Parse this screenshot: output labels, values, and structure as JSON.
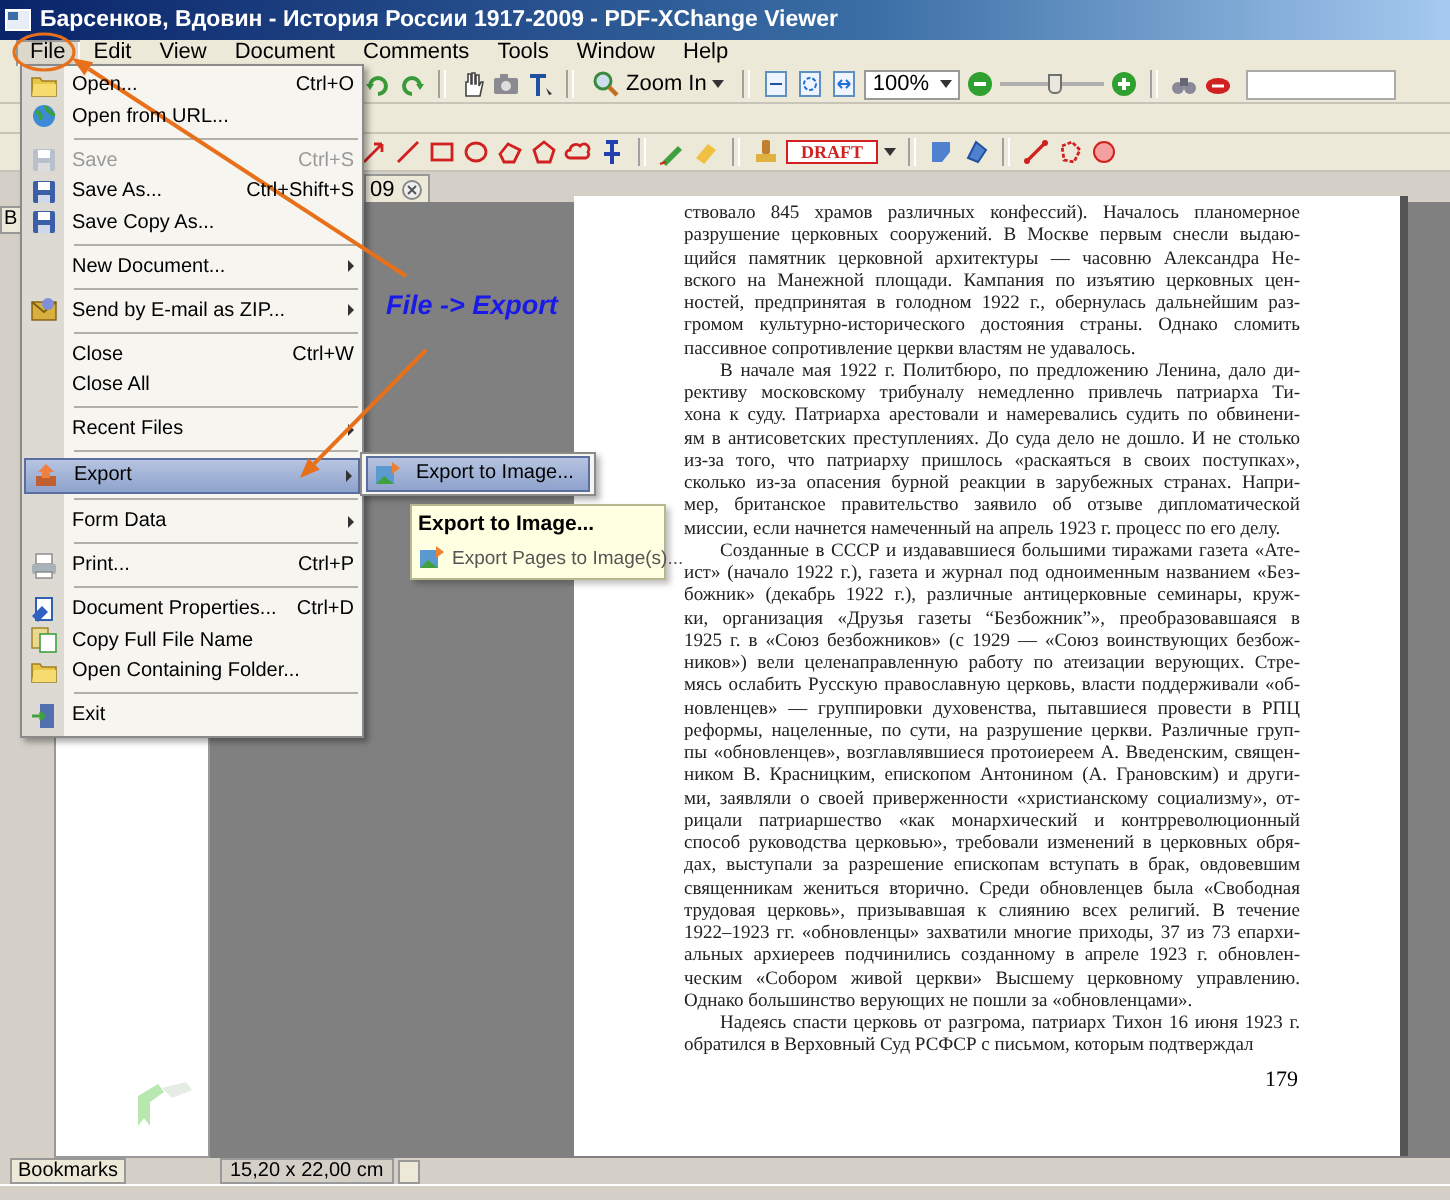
{
  "window": {
    "title": "Барсенков, Вдовин - История России 1917-2009 - PDF-XChange Viewer"
  },
  "menubar": [
    {
      "label": "File",
      "selected": true
    },
    {
      "label": "Edit",
      "selected": false
    },
    {
      "label": "View",
      "selected": false
    },
    {
      "label": "Document",
      "selected": false
    },
    {
      "label": "Comments",
      "selected": false
    },
    {
      "label": "Tools",
      "selected": false
    },
    {
      "label": "Window",
      "selected": false
    },
    {
      "label": "Help",
      "selected": false
    }
  ],
  "toolbar": {
    "zoom_button": "Zoom In",
    "zoom_value": "100%",
    "zoom_slider": {
      "level": 0.52
    },
    "stamp": "DRAFT"
  },
  "document_tab": {
    "label": "09"
  },
  "left_panel": {
    "tab": "B",
    "bottom_tab": "Bookmarks"
  },
  "page": {
    "paragraphs": [
      {
        "indent": false,
        "lines": [
          "ствовало 845 храмов различных конфессий). Началось планомерное",
          "разрушение церковных сооружений. В Москве первым снесли выдаю-",
          "щийся памятник церковной архитектуры — часовню Александра Не-",
          "вского на Манежной площади. Кампания по изъятию церковных цен-",
          "ностей, предпринятая в голодном 1922 г., обернулась дальнейшим раз-",
          "громом культурно-исторического достояния страны. Однако сломить",
          "пассивное сопротивление церкви властям не удавалось."
        ]
      },
      {
        "indent": true,
        "lines": [
          "В начале мая 1922 г. Политбюро, по предложению Ленина, дало ди-",
          "рективу московскому трибуналу немедленно привлечь патриарха Ти-",
          "хона к суду. Патриарха арестовали и намеревались судить по обвинени-",
          "ям в антисоветских преступлениях. До суда дело не дошло. И не столько",
          "из-за того, что патриарху пришлось «раскаяться в своих поступках»,",
          "сколько из-за опасения бурной реакции в зарубежных странах. Напри-",
          "мер, британское правительство заявило об отзыве дипломатической",
          "миссии, если начнется намеченный на апрель 1923 г. процесс по его делу."
        ]
      },
      {
        "indent": true,
        "lines": [
          "Созданные в СССР и издававшиеся большими тиражами газета «Ате-",
          "ист» (начало 1922 г.), газета и журнал под одноименным названием «Без-",
          "божник» (декабрь 1922 г.), различные антицерковные семинары, круж-",
          "ки, организация «Друзья газеты “Безбожник”», преобразовавшаяся в",
          "1925 г. в «Союз безбожников» (с 1929 — «Союз воинствующих безбож-",
          "ников») вели целенаправленную работу по атеизации верующих. Стре-",
          "мясь ослабить Русскую православную церковь, власти поддерживали «об-",
          "новленцев» — группировки духовенства, пытавшиеся провести в РПЦ",
          "реформы, нацеленные, по сути, на разрушение церкви. Различные груп-",
          "пы «обновленцев», возглавлявшиеся протоиереем А. Введенским, священ-",
          "ником В. Красницким, епископом Антонином (А. Грановским) и други-",
          "ми, заявляли о своей приверженности «христианскому социализму», от-",
          "рицали патриаршество «как монархический и контрреволюционный",
          "способ руководства церковью», требовали изменений в церковных обря-",
          "дах, выступали за разрешение епископам вступать в брак, овдовевшим",
          "священникам жениться вторично. Среди обновленцев была «Свободная",
          "трудовая церковь», призывавшая к слиянию всех религий. В течение",
          "1922–1923 гг. «обновленцы» захватили многие приходы, 37 из 73 епархи-",
          "альных архиереев подчинились созданному в апреле 1923 г. обновлен-",
          "ческим «Собором живой церкви» Высшему церковному управлению.",
          "Однако большинство верующих не пошли за «обновленцами»."
        ]
      },
      {
        "indent": true,
        "lines": [
          "Надеясь спасти церковь от разгрома, патриарх Тихон 16 июня 1923 г.",
          "обратился в Верховный Суд РСФСР с письмом, которым подтверждал"
        ]
      }
    ],
    "page_number": "179"
  },
  "status_bar": {
    "page_size": "15,20 x 22,00 cm"
  },
  "file_menu": {
    "items": [
      {
        "kind": "item",
        "label": "Open...",
        "shortcut": "Ctrl+O",
        "disabled": false,
        "selected": false,
        "submenu": false
      },
      {
        "kind": "item",
        "label": "Open from URL...",
        "disabled": false,
        "selected": false,
        "submenu": false
      },
      {
        "kind": "separator"
      },
      {
        "kind": "item",
        "label": "Save",
        "shortcut": "Ctrl+S",
        "disabled": true,
        "selected": false,
        "submenu": false
      },
      {
        "kind": "item",
        "label": "Save As...",
        "shortcut": "Ctrl+Shift+S",
        "disabled": false,
        "selected": false,
        "submenu": false
      },
      {
        "kind": "item",
        "label": "Save Copy As...",
        "disabled": false,
        "selected": false,
        "submenu": false
      },
      {
        "kind": "separator"
      },
      {
        "kind": "item",
        "label": "New Document...",
        "disabled": false,
        "selected": false,
        "submenu": true
      },
      {
        "kind": "separator"
      },
      {
        "kind": "item",
        "label": "Send by E-mail as ZIP...",
        "disabled": false,
        "selected": false,
        "submenu": true
      },
      {
        "kind": "separator"
      },
      {
        "kind": "item",
        "label": "Close",
        "shortcut": "Ctrl+W",
        "disabled": false,
        "selected": false,
        "submenu": false
      },
      {
        "kind": "item",
        "label": "Close All",
        "disabled": false,
        "selected": false,
        "submenu": false
      },
      {
        "kind": "separator"
      },
      {
        "kind": "item",
        "label": "Recent Files",
        "disabled": false,
        "selected": false,
        "submenu": true
      },
      {
        "kind": "separator"
      },
      {
        "kind": "item",
        "label": "Export",
        "disabled": false,
        "selected": true,
        "submenu": true
      },
      {
        "kind": "separator"
      },
      {
        "kind": "item",
        "label": "Form Data",
        "disabled": false,
        "selected": false,
        "submenu": true
      },
      {
        "kind": "separator"
      },
      {
        "kind": "item",
        "label": "Print...",
        "shortcut": "Ctrl+P",
        "disabled": false,
        "selected": false,
        "submenu": false
      },
      {
        "kind": "separator"
      },
      {
        "kind": "item",
        "label": "Document Properties...",
        "shortcut": "Ctrl+D",
        "disabled": false,
        "selected": false,
        "submenu": false
      },
      {
        "kind": "item",
        "label": "Copy Full File Name",
        "disabled": false,
        "selected": false,
        "submenu": false
      },
      {
        "kind": "item",
        "label": "Open Containing Folder...",
        "disabled": false,
        "selected": false,
        "submenu": false
      },
      {
        "kind": "separator"
      },
      {
        "kind": "item",
        "label": "Exit",
        "disabled": false,
        "selected": false,
        "submenu": false
      }
    ]
  },
  "export_submenu": {
    "items": [
      {
        "label": "Export to Image...",
        "selected": true
      }
    ]
  },
  "tooltip": {
    "title": "Export to Image...",
    "item": "Export Pages to Image(s)..."
  },
  "annotation": {
    "label": "File -> Export"
  }
}
